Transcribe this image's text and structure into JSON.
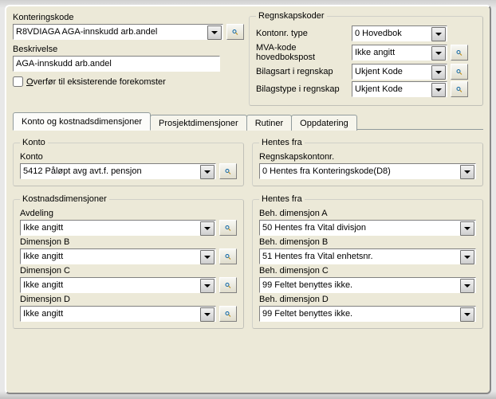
{
  "top_left": {
    "konteringskode_label": "Konteringskode",
    "konteringskode_value": "R8VDIAGA AGA-innskudd arb.andel",
    "beskrivelse_label": "Beskrivelse",
    "beskrivelse_value": "AGA-innskudd arb.andel",
    "overfor_prefix": "O",
    "overfor_rest": "verfør til eksisterende forekomster"
  },
  "regnskap": {
    "legend": "Regnskapskoder",
    "rows": [
      {
        "label": "Kontonr. type",
        "value": "0 Hovedbok",
        "has_mag": false
      },
      {
        "label": "MVA-kode hovedbokspost",
        "value": "Ikke angitt",
        "has_mag": true
      },
      {
        "label": "Bilagsart i regnskap",
        "value": "Ukjent Kode",
        "has_mag": true
      },
      {
        "label": "Bilagstype i regnskap",
        "value": "Ukjent Kode",
        "has_mag": true
      }
    ]
  },
  "tabs": [
    "Konto og kostnadsdimensjoner",
    "Prosjektdimensjoner",
    "Rutiner",
    "Oppdatering"
  ],
  "konto": {
    "legend": "Konto",
    "label": "Konto",
    "value": "5412 Påløpt avg avt.f. pensjon"
  },
  "hentes1": {
    "legend": "Hentes fra",
    "label": "Regnskapskontonr.",
    "value": "0 Hentes fra Konteringskode(D8)"
  },
  "kost": {
    "legend": "Kostnadsdimensjoner",
    "items": [
      {
        "label": "Avdeling",
        "value": "Ikke angitt"
      },
      {
        "label": "Dimensjon B",
        "value": "Ikke angitt"
      },
      {
        "label": "Dimensjon C",
        "value": "Ikke angitt"
      },
      {
        "label": "Dimensjon D",
        "value": "Ikke angitt"
      }
    ]
  },
  "hentes2": {
    "legend": "Hentes fra",
    "items": [
      {
        "label": "Beh. dimensjon A",
        "value": "50 Hentes fra Vital divisjon"
      },
      {
        "label": "Beh. dimensjon B",
        "value": "51 Hentes fra Vital enhetsnr."
      },
      {
        "label": "Beh. dimensjon C",
        "value": "99 Feltet benyttes ikke."
      },
      {
        "label": "Beh. dimensjon D",
        "value": "99 Feltet benyttes ikke."
      }
    ]
  }
}
